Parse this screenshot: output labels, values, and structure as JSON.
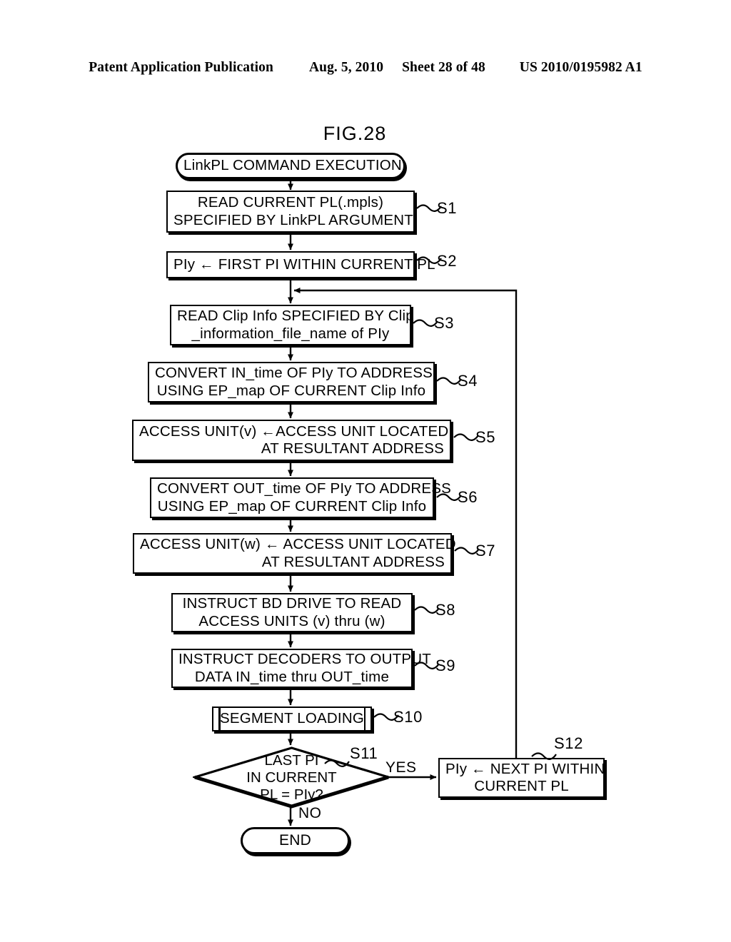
{
  "header": {
    "publication": "Patent Application Publication",
    "date": "Aug. 5, 2010",
    "sheet": "Sheet 28 of 48",
    "document_number": "US 2010/0195982 A1"
  },
  "figure": {
    "title": "FIG.28"
  },
  "flowchart": {
    "start": {
      "label": "LinkPL COMMAND EXECUTION"
    },
    "end": {
      "label": "END"
    },
    "steps": [
      {
        "id": "S1",
        "tag": "S1",
        "lines": [
          "READ CURRENT PL(.mpls)",
          "SPECIFIED BY LinkPL ARGUMENT"
        ]
      },
      {
        "id": "S2",
        "tag": "S2",
        "lines": [
          "PIy ← FIRST PI WITHIN CURRENT PL"
        ]
      },
      {
        "id": "S3",
        "tag": "S3",
        "lines": [
          "READ Clip Info SPECIFIED BY Clip",
          "_information_file_name of PIy"
        ]
      },
      {
        "id": "S4",
        "tag": "S4",
        "lines": [
          "CONVERT IN_time OF PIy TO ADDRESS",
          "USING EP_map OF CURRENT Clip Info"
        ]
      },
      {
        "id": "S5",
        "tag": "S5",
        "lines": [
          "ACCESS UNIT(v) ←ACCESS UNIT LOCATED",
          "AT RESULTANT ADDRESS"
        ]
      },
      {
        "id": "S6",
        "tag": "S6",
        "lines": [
          "CONVERT OUT_time OF PIy TO ADDRESS",
          "USING EP_map OF CURRENT Clip Info"
        ]
      },
      {
        "id": "S7",
        "tag": "S7",
        "lines": [
          "ACCESS UNIT(w) ← ACCESS UNIT LOCATED",
          "AT RESULTANT ADDRESS"
        ]
      },
      {
        "id": "S8",
        "tag": "S8",
        "lines": [
          "INSTRUCT BD DRIVE TO READ",
          "ACCESS UNITS (v) thru (w)"
        ]
      },
      {
        "id": "S9",
        "tag": "S9",
        "lines": [
          "INSTRUCT DECODERS TO OUTPUT",
          "DATA IN_time thru OUT_time"
        ]
      },
      {
        "id": "S10",
        "tag": "S10",
        "lines": [
          "SEGMENT LOADING"
        ]
      },
      {
        "id": "S11",
        "tag": "S11",
        "lines": [
          "LAST PI",
          "IN CURRENT",
          "PL = PIy?"
        ]
      },
      {
        "id": "S12",
        "tag": "S12",
        "lines": [
          "PIy ← NEXT PI WITHIN",
          "CURRENT PL"
        ]
      }
    ],
    "edges": {
      "yes": "YES",
      "no": "NO"
    }
  },
  "colors": {
    "ink": "#000000",
    "paper": "#ffffff"
  }
}
